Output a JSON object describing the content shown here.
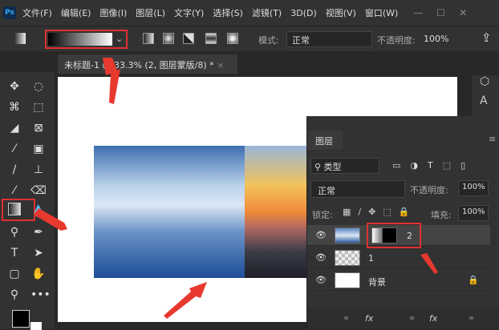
{
  "app": {
    "logo": "Ps"
  },
  "menu": [
    "文件(F)",
    "编辑(E)",
    "图像(I)",
    "图层(L)",
    "文字(Y)",
    "选择(S)",
    "滤镜(T)",
    "3D(D)",
    "视图(V)",
    "窗口(W)"
  ],
  "window_controls": [
    "—",
    "☐",
    "✕"
  ],
  "options": {
    "mode_label": "模式:",
    "mode_value": "正常",
    "opacity_label": "不透明度:",
    "opacity_value": "100%"
  },
  "document_tab": {
    "title": "未标题-1 @ 33.3% (2, 图层蒙版/8) *",
    "close": "×"
  },
  "layers_panel": {
    "title": "图层",
    "filter_kind": "类型",
    "blend_mode": "正常",
    "opacity_label": "不透明度:",
    "opacity_value": "100%",
    "lock_label": "锁定:",
    "fill_label": "填充:",
    "fill_value": "100%",
    "layers": [
      {
        "name": "2",
        "selected": true,
        "has_mask": true
      },
      {
        "name": "1"
      },
      {
        "name": "背景",
        "locked": true
      }
    ],
    "footer": [
      "⚭",
      "fx",
      "⚭",
      "fx",
      "⚭"
    ]
  },
  "colors": {
    "highlight": "#e03030",
    "accent": "#31a8ff"
  }
}
